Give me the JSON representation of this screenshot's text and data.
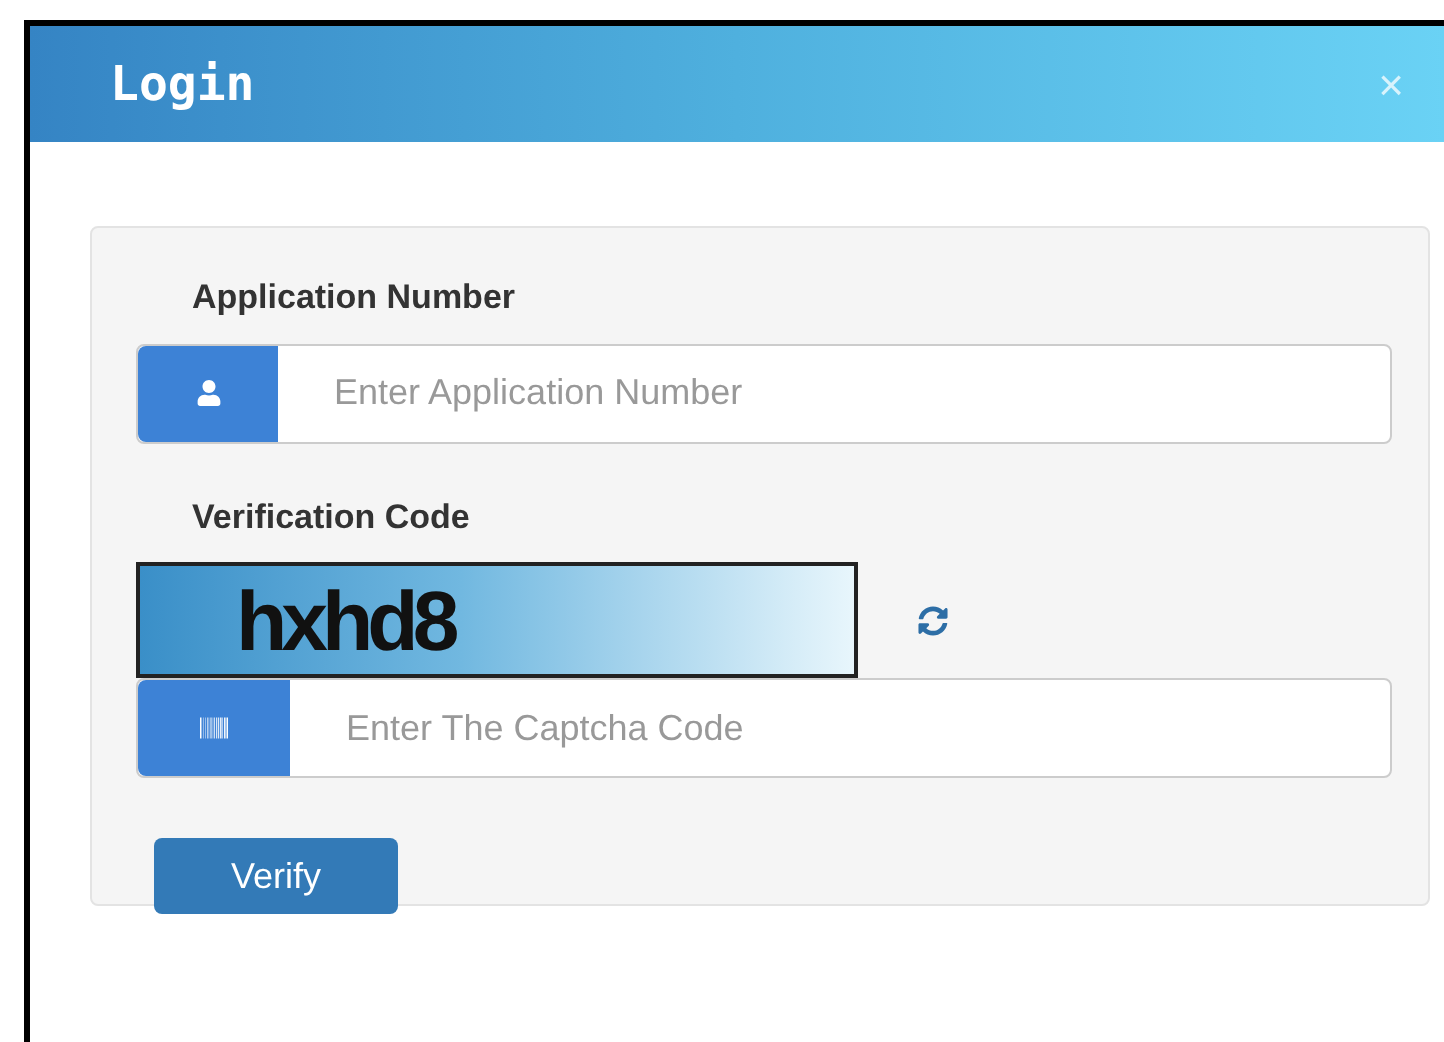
{
  "window": {
    "title": "Login",
    "close": "×"
  },
  "form": {
    "application_label": "Application Number",
    "application_placeholder": "Enter Application Number",
    "verification_label": "Verification Code",
    "captcha_text": "hxhd8",
    "captcha_placeholder": "Enter The Captcha Code",
    "button": "Verify"
  }
}
